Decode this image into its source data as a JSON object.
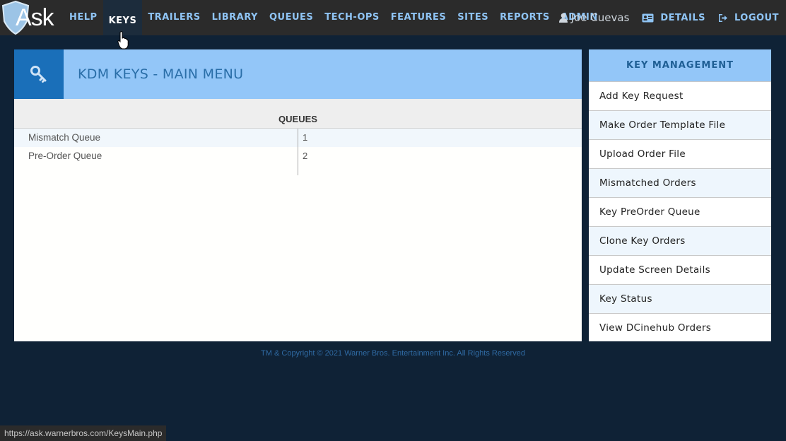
{
  "logo": {
    "text": "Ask"
  },
  "nav": {
    "items": [
      "HELP",
      "KEYS",
      "TRAILERS",
      "LIBRARY",
      "QUEUES",
      "TECH-OPS",
      "FEATURES",
      "SITES",
      "REPORTS",
      "ADMIN"
    ],
    "active": "KEYS"
  },
  "user": {
    "name": "Joe Cuevas"
  },
  "right_nav": {
    "details": "DETAILS",
    "logout": "LOGOUT"
  },
  "main": {
    "title": "KDM KEYS - MAIN MENU",
    "queues_header": "QUEUES",
    "rows": [
      {
        "name": "Mismatch Queue",
        "count": "1"
      },
      {
        "name": "Pre-Order Queue",
        "count": "2"
      }
    ]
  },
  "side": {
    "title": "KEY MANAGEMENT",
    "items": [
      "Add Key Request",
      "Make Order Template File",
      "Upload Order File",
      "Mismatched Orders",
      "Key PreOrder Queue",
      "Clone Key Orders",
      "Update Screen Details",
      "Key Status",
      "View DCinehub Orders"
    ]
  },
  "footer": {
    "text": "TM & Copyright © 2021 Warner Bros. Entertainment Inc. All Rights Reserved"
  },
  "status_bar": {
    "url": "https://ask.warnerbros.com/KeysMain.php"
  },
  "colors": {
    "background": "#0f2236",
    "topbar": "#2b2b2b",
    "nav_link": "#8fc4f4",
    "header_light": "#93c6f8",
    "icon_box": "#1a6fb9",
    "title_text": "#2a6ea8"
  }
}
